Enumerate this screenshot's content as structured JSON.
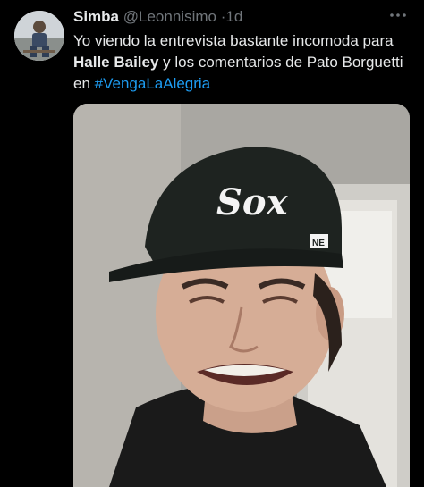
{
  "tweet": {
    "author_name": "Simba",
    "handle": "@Leonnisimo",
    "separator": "·",
    "time": "1d",
    "text_part1": "Yo viendo la entrevista bastante incomoda para ",
    "text_bold": "Halle Bailey",
    "text_part2": " y los comentarios de Pato Borguetti en ",
    "hashtag": "#VengaLaAlegria",
    "more_icon": "ellipsis-icon"
  },
  "media": {
    "cap_logo": "Sox",
    "cap_brand": "NE"
  },
  "colors": {
    "background": "#000000",
    "text": "#e7e9ea",
    "secondary": "#71767b",
    "link": "#1d9bf0"
  }
}
